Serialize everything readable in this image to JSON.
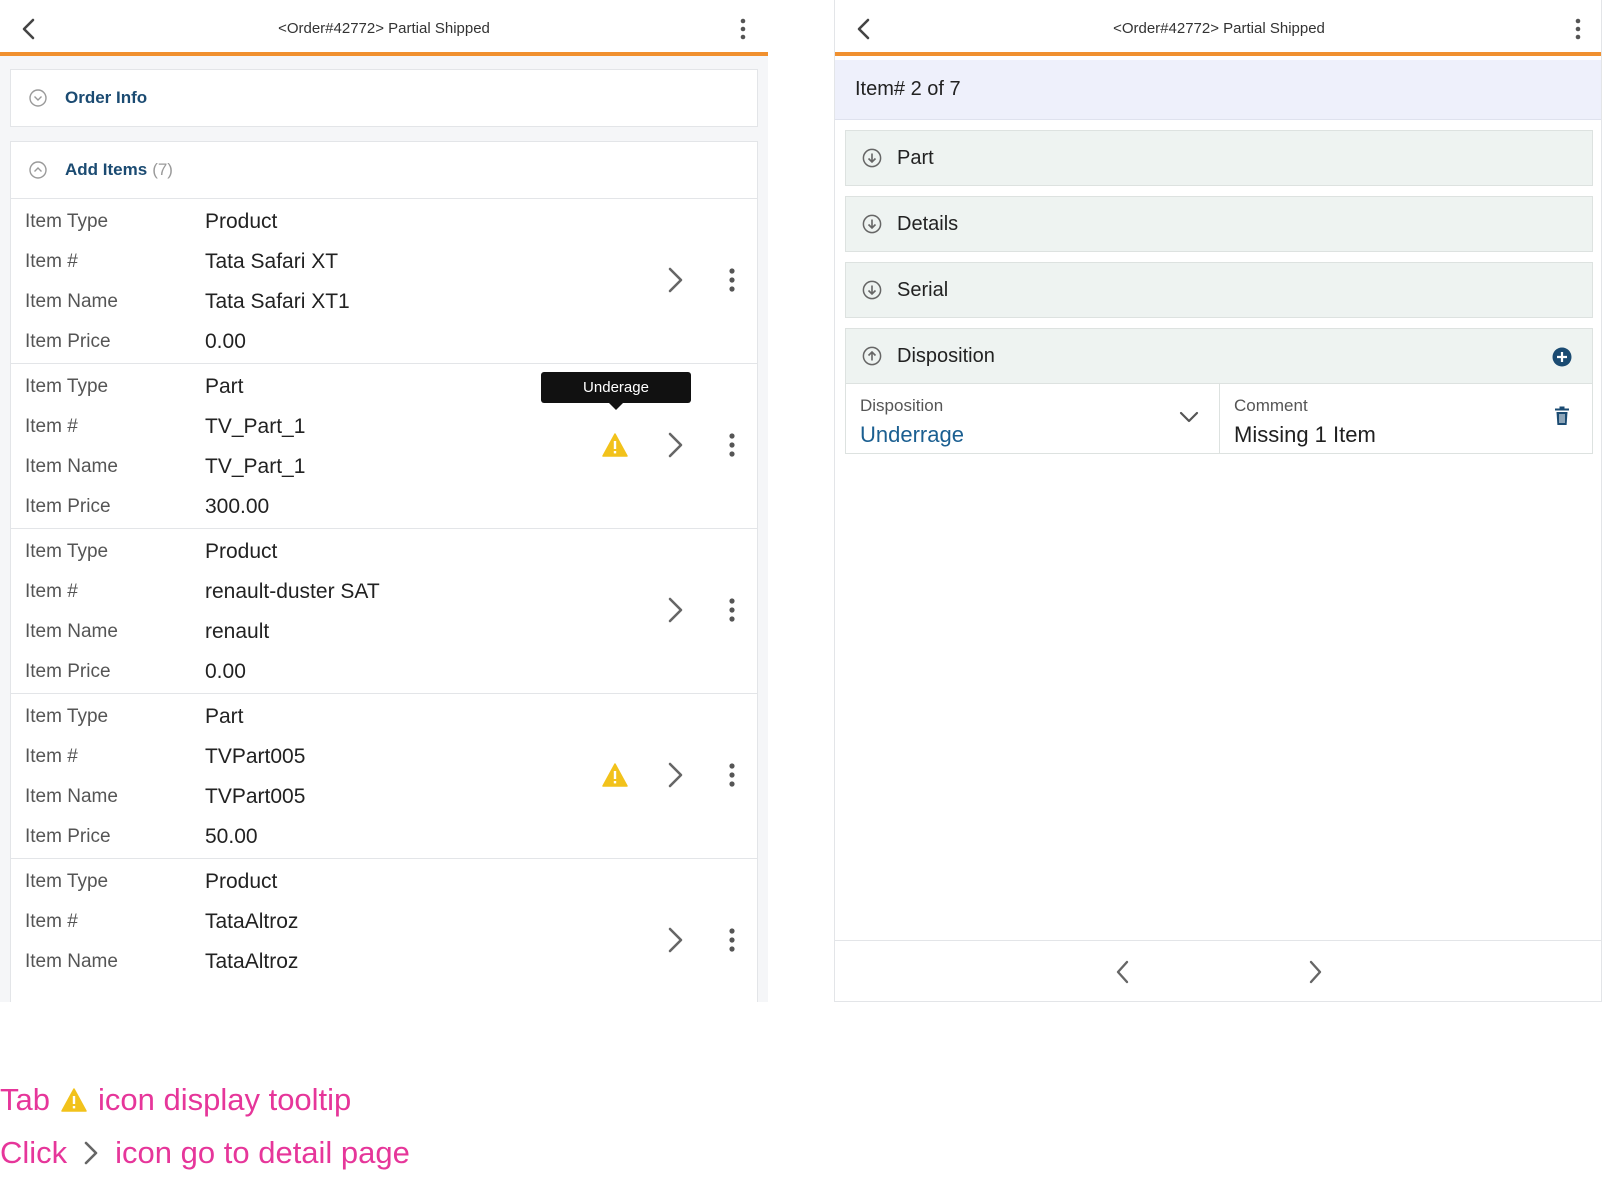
{
  "left": {
    "title": "<Order#42772> Partial Shipped",
    "order_info_label": "Order Info",
    "add_items_label": "Add Items",
    "add_items_count": "(7)",
    "field_labels": {
      "type": "Item Type",
      "number": "Item #",
      "name": "Item Name",
      "price": "Item Price"
    },
    "items": [
      {
        "type": "Product",
        "number": "Tata Safari XT",
        "name": "Tata Safari XT1",
        "price": "0.00",
        "warning": false
      },
      {
        "type": "Part",
        "number": "TV_Part_1",
        "name": "TV_Part_1",
        "price": "300.00",
        "warning": true
      },
      {
        "type": "Product",
        "number": "renault-duster SAT",
        "name": "renault",
        "price": "0.00",
        "warning": false
      },
      {
        "type": "Part",
        "number": "TVPart005",
        "name": "TVPart005",
        "price": "50.00",
        "warning": true
      },
      {
        "type": "Product",
        "number": "TataAltroz",
        "name": "TataAltroz",
        "price": "",
        "warning": false
      }
    ],
    "tooltip": "Underage"
  },
  "right": {
    "title": "<Order#42772> Partial Shipped",
    "item_counter": "Item# 2 of 7",
    "sections": {
      "part": "Part",
      "details": "Details",
      "serial": "Serial",
      "disposition": "Disposition"
    },
    "disposition_label": "Disposition",
    "disposition_value": "Underrage",
    "comment_label": "Comment",
    "comment_value": "Missing 1 Item"
  },
  "notes": {
    "line1_before": "Tab",
    "line1_after": "icon display tooltip",
    "line2_before": "Click",
    "line2_after": "icon go to detail page"
  },
  "colors": {
    "accent_orange": "#f0902f",
    "heading_blue": "#1b4b72",
    "value_blue": "#1b5f91",
    "warning_yellow": "#f2c21b",
    "annotation_pink": "#e6369a",
    "counter_bg": "#eef0fb",
    "accordion_bg": "#eef3f1"
  },
  "icons": {
    "back": "chevron-left-icon",
    "menu": "kebab-icon",
    "expand": "circle-chevron-icon",
    "warning": "warning-triangle-icon",
    "detail": "chevron-right-icon",
    "add": "plus-circle-icon",
    "delete": "trash-icon",
    "dropdown": "chevron-down-icon"
  }
}
